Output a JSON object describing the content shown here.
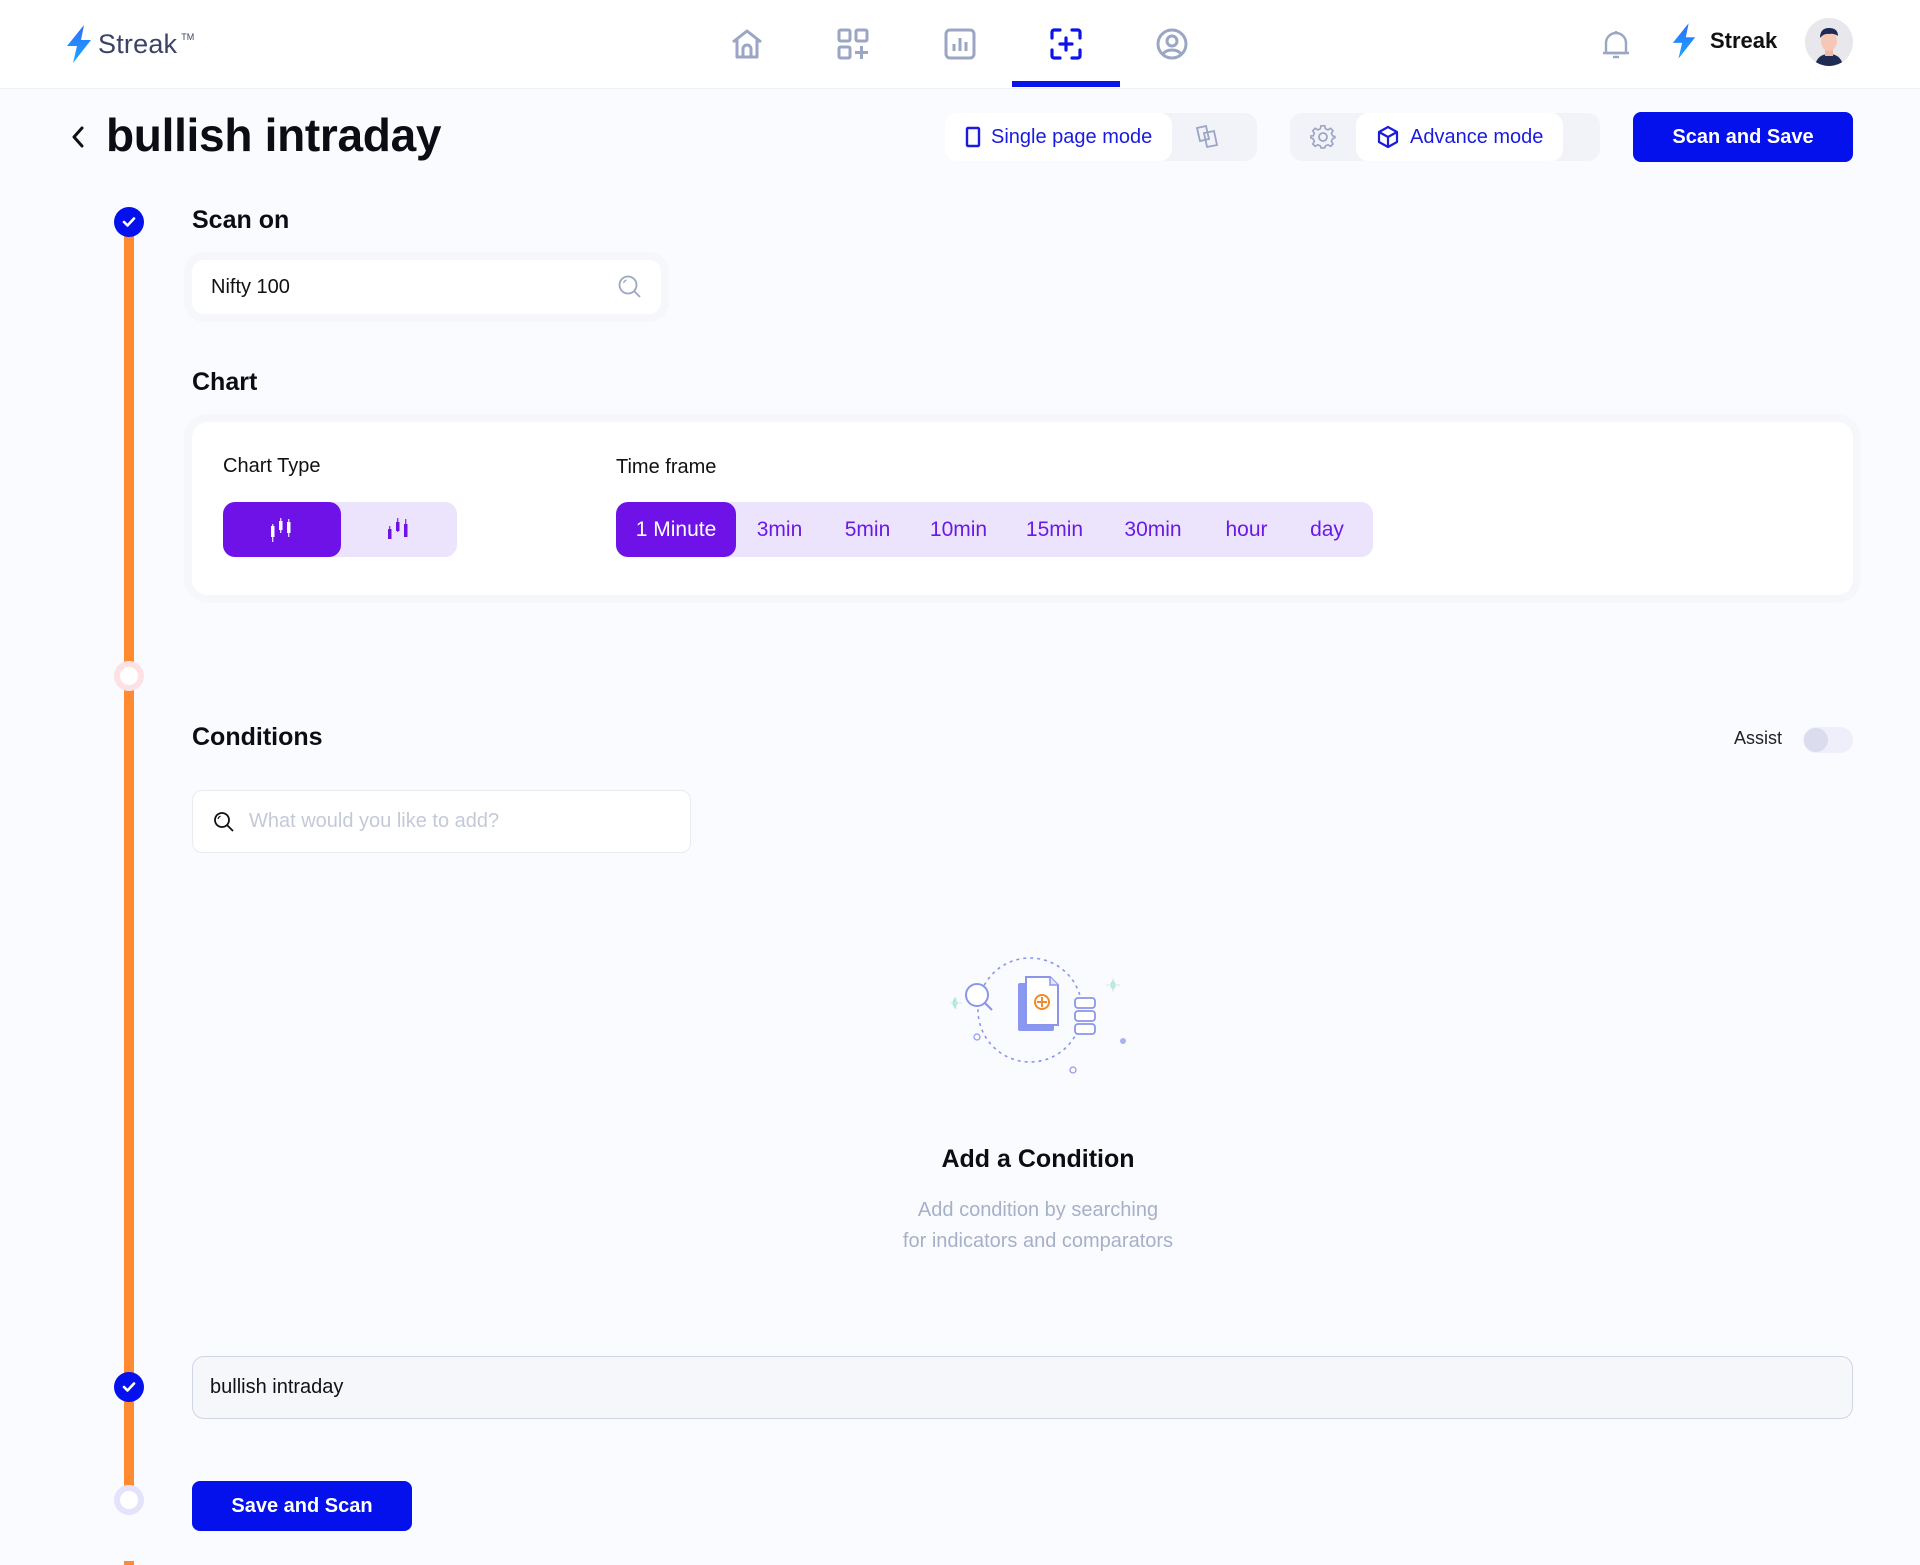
{
  "header": {
    "logo_text": "Streak",
    "logo_tm": "TM",
    "nav": [
      {
        "icon": "home-icon",
        "label": "Home",
        "active": false
      },
      {
        "icon": "apps-add-icon",
        "label": "Create",
        "active": false
      },
      {
        "icon": "bar-chart-icon",
        "label": "Dashboard",
        "active": false
      },
      {
        "icon": "scan-add-icon",
        "label": "Scanner",
        "active": true
      },
      {
        "icon": "user-circle-icon",
        "label": "Profile",
        "active": false
      }
    ],
    "brand_right_text": "Streak",
    "accent_color": "#0a14ea"
  },
  "page": {
    "title": "bullish intraday",
    "single_page_mode_label": "Single page mode",
    "advance_mode_label": "Advance mode",
    "scan_and_save_label": "Scan and Save"
  },
  "scan_on": {
    "title": "Scan on",
    "value": "Nifty 100"
  },
  "chart": {
    "title": "Chart",
    "chart_type_label": "Chart Type",
    "chart_types": [
      {
        "icon": "candlestick-icon",
        "active": true
      },
      {
        "icon": "heikin-ashi-icon",
        "active": false
      }
    ],
    "time_frame_label": "Time frame",
    "time_frames": [
      {
        "label": "1 Minute",
        "active": true
      },
      {
        "label": "3min",
        "active": false
      },
      {
        "label": "5min",
        "active": false
      },
      {
        "label": "10min",
        "active": false
      },
      {
        "label": "15min",
        "active": false
      },
      {
        "label": "30min",
        "active": false
      },
      {
        "label": "hour",
        "active": false
      },
      {
        "label": "day",
        "active": false
      }
    ],
    "active_color": "#6e12e8"
  },
  "conditions": {
    "title": "Conditions",
    "assist_label": "Assist",
    "assist_on": false,
    "search_placeholder": "What would you like to add?",
    "search_value": "",
    "empty_title": "Add a Condition",
    "empty_sub_line1": "Add condition by searching",
    "empty_sub_line2": "for indicators and comparators"
  },
  "scan_name": {
    "value": "bullish intraday"
  },
  "footer": {
    "save_and_scan_label": "Save and Scan"
  },
  "timeline_color": "#ff8a32"
}
